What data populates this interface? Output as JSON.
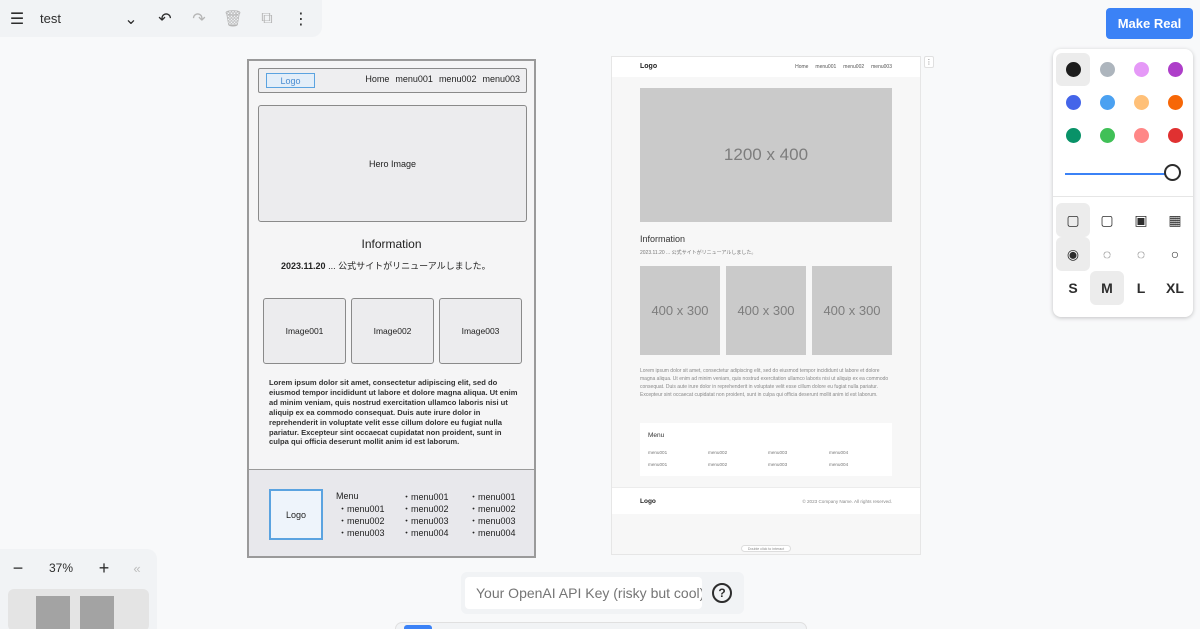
{
  "toolbar": {
    "doc_title": "test",
    "menu_icon": "☰",
    "chevron_icon": "⌄",
    "undo_icon": "↶",
    "redo_icon": "↷",
    "delete_icon": "🗑",
    "duplicate_icon": "⧉",
    "more_icon": "⋮"
  },
  "make_real": {
    "label": "Make Real",
    "color": "#3b82f6"
  },
  "style_panel": {
    "colors": [
      "#1d1d1d",
      "#adb5bd",
      "#e599f7",
      "#ae3ec9",
      "#4465e9",
      "#4ba1f1",
      "#ffc078",
      "#f76707",
      "#099268",
      "#40c057",
      "#ff8787",
      "#e03131"
    ],
    "selected_color_index": 0,
    "opacity": 1.0,
    "fill_icons": [
      "▢",
      "▢",
      "▣",
      "▦"
    ],
    "dash_icons": [
      "◉",
      "◌",
      "◌",
      "○"
    ],
    "sizes": [
      "S",
      "M",
      "L",
      "XL"
    ],
    "selected_size": "M"
  },
  "zoom": {
    "minus": "−",
    "value": "37%",
    "plus": "+",
    "collapse": "«"
  },
  "api_key": {
    "placeholder": "Your OpenAI API Key (risky but cool)",
    "help": "?"
  },
  "wireframe": {
    "logo": "Logo",
    "nav": [
      "Home",
      "menu001",
      "menu002",
      "menu003"
    ],
    "hero": "Hero Image",
    "info_title": "Information",
    "news_date": "2023.11.20",
    "news_text": " ... 公式サイトがリニューアルしました。",
    "images": [
      "Image001",
      "Image002",
      "Image003"
    ],
    "lorem": "Lorem ipsum dolor sit amet, consectetur adipiscing elit, sed do eiusmod tempor incididunt ut labore et dolore magna aliqua. Ut enim ad minim veniam, quis nostrud exercitation ullamco laboris nisi ut aliquip ex ea commodo consequat. Duis aute irure dolor in reprehenderit in voluptate velit esse cillum dolore eu fugiat nulla pariatur. Excepteur sint occaecat cupidatat non proident, sunt in culpa qui officia deserunt mollit anim id est laborum.",
    "footer_logo": "Logo",
    "footer_menu_title": "Menu",
    "footer_col1": [
      "・menu001",
      "・menu002",
      "・menu003"
    ],
    "footer_col2": [
      "・menu001",
      "・menu002",
      "・menu003",
      "・menu004"
    ],
    "footer_col3": [
      "・menu001",
      "・menu002",
      "・menu003",
      "・menu004"
    ]
  },
  "generated": {
    "logo": "Logo",
    "nav": [
      "Home",
      "menu001",
      "menu002",
      "menu003"
    ],
    "hero": "1200 x 400",
    "info_title": "Information",
    "news": "2023.11.20 ... 公式サイトがリニューアルしました。",
    "images": [
      "400 x 300",
      "400 x 300",
      "400 x 300"
    ],
    "lorem": "Lorem ipsum dolor sit amet, consectetur adipiscing elit, sed do eiusmod tempor incididunt ut labore et dolore magna aliqua. Ut enim ad minim veniam, quis nostrud exercitation ullamco laboris nisi ut aliquip ex ea commodo consequat. Duis aute irure dolor in reprehenderit in voluptate velit esse cillum dolore eu fugiat nulla pariatur. Excepteur sint occaecat cupidatat non proident, sunt in culpa qui officia deserunt mollit anim id est laborum.",
    "menu_title": "Menu",
    "menu_cols": [
      [
        "menu001",
        "menu001"
      ],
      [
        "menu002",
        "menu002"
      ],
      [
        "menu003",
        "menu003"
      ],
      [
        "menu004",
        "menu004"
      ]
    ],
    "footer_logo": "Logo",
    "copyright": "© 2023 Company Name. All rights reserved.",
    "dblclick": "Double click to interact",
    "handle_icon": "⋮"
  }
}
